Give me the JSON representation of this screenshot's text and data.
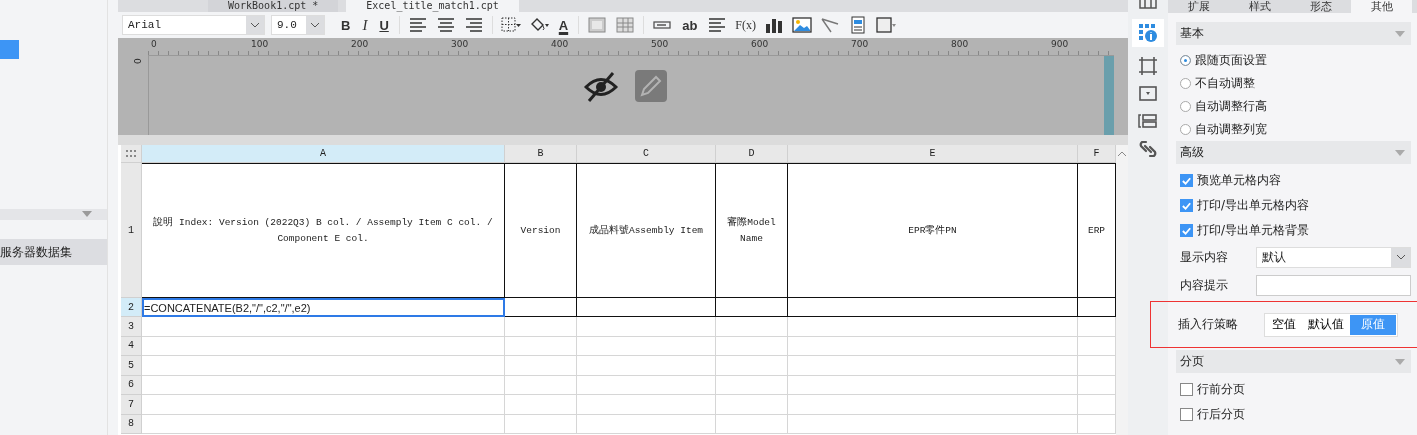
{
  "file_tabs": [
    {
      "label": "WorkBook1.cpt *",
      "selected": false
    },
    {
      "label": "Excel_title_match1.cpt",
      "selected": true
    }
  ],
  "sidebar": {
    "items": [
      {
        "label": "服务器数据集",
        "selected": true
      }
    ]
  },
  "toolbar": {
    "font": "Arial",
    "size": "9.0",
    "buttons": [
      {
        "kind": "bold",
        "label": "B"
      },
      {
        "kind": "italic",
        "label": "I"
      },
      {
        "kind": "underline",
        "label": "U"
      },
      {
        "kind": "sep"
      },
      {
        "kind": "align-left"
      },
      {
        "kind": "align-center"
      },
      {
        "kind": "align-right"
      },
      {
        "kind": "sep"
      },
      {
        "kind": "borders"
      },
      {
        "kind": "fill"
      },
      {
        "kind": "font-color",
        "label": "A"
      },
      {
        "kind": "sep"
      },
      {
        "kind": "merge"
      },
      {
        "kind": "split"
      },
      {
        "kind": "sep"
      },
      {
        "kind": "field"
      },
      {
        "kind": "text",
        "label": "ab"
      },
      {
        "kind": "paragraph"
      },
      {
        "kind": "formula",
        "label": "F(x)"
      },
      {
        "kind": "chart"
      },
      {
        "kind": "image"
      },
      {
        "kind": "slash"
      },
      {
        "kind": "subreport"
      },
      {
        "kind": "frame"
      }
    ]
  },
  "ruler": {
    "ticks": [
      "0",
      "100",
      "200",
      "300",
      "400",
      "500",
      "600",
      "700",
      "800",
      "900"
    ],
    "vertical": "0"
  },
  "grid": {
    "columns": [
      {
        "label": "A",
        "selected": true
      },
      {
        "label": "B",
        "selected": false
      },
      {
        "label": "C",
        "selected": false
      },
      {
        "label": "D",
        "selected": false
      },
      {
        "label": "E",
        "selected": false
      },
      {
        "label": "F",
        "selected": false
      }
    ],
    "rows": [
      {
        "number": "1",
        "selected": false,
        "cells": [
          {
            "text": "說明 Index: Version (2022Q3) B col. / Assemply Item C col. / Component E col.",
            "selected": false
          },
          {
            "text": "Version",
            "selected": false
          },
          {
            "text": "成品料號Assembly Item",
            "selected": false
          },
          {
            "text": "審際Model Name",
            "selected": false
          },
          {
            "text": "EPR零件PN",
            "selected": false
          },
          {
            "text": "ERP",
            "selected": false
          }
        ]
      },
      {
        "number": "2",
        "selected": true,
        "cells": [
          {
            "text": "=CONCATENATE(B2,\"/\",c2,\"/\",e2)",
            "selected": true
          }
        ]
      },
      {
        "number": "3",
        "selected": false
      },
      {
        "number": "4",
        "selected": false
      },
      {
        "number": "5",
        "selected": false
      },
      {
        "number": "6",
        "selected": false
      },
      {
        "number": "7",
        "selected": false
      },
      {
        "number": "8",
        "selected": false
      }
    ]
  },
  "panel": {
    "tabs": [
      {
        "label": "扩展",
        "selected": false
      },
      {
        "label": "样式",
        "selected": false
      },
      {
        "label": "形态",
        "selected": false
      },
      {
        "label": "其他",
        "selected": true
      }
    ],
    "basic": {
      "title": "基本",
      "options": [
        {
          "label": "跟随页面设置",
          "selected": true
        },
        {
          "label": "不自动调整",
          "selected": false
        },
        {
          "label": "自动调整行高",
          "selected": false
        },
        {
          "label": "自动调整列宽",
          "selected": false
        }
      ]
    },
    "advanced": {
      "title": "高级",
      "checks": [
        {
          "label": "预览单元格内容",
          "checked": true
        },
        {
          "label": "打印/导出单元格内容",
          "checked": true
        },
        {
          "label": "打印/导出单元格背景",
          "checked": true
        }
      ],
      "display": {
        "label": "显示内容",
        "value": "默认"
      },
      "tip": {
        "label": "内容提示"
      },
      "insert": {
        "label": "插入行策略",
        "options": [
          {
            "label": "空值",
            "selected": false
          },
          {
            "label": "默认值",
            "selected": false
          },
          {
            "label": "原值",
            "selected": true
          }
        ]
      }
    },
    "paging": {
      "title": "分页",
      "checks": [
        {
          "label": "行前分页",
          "checked": false
        },
        {
          "label": "行后分页",
          "checked": false
        }
      ]
    }
  }
}
